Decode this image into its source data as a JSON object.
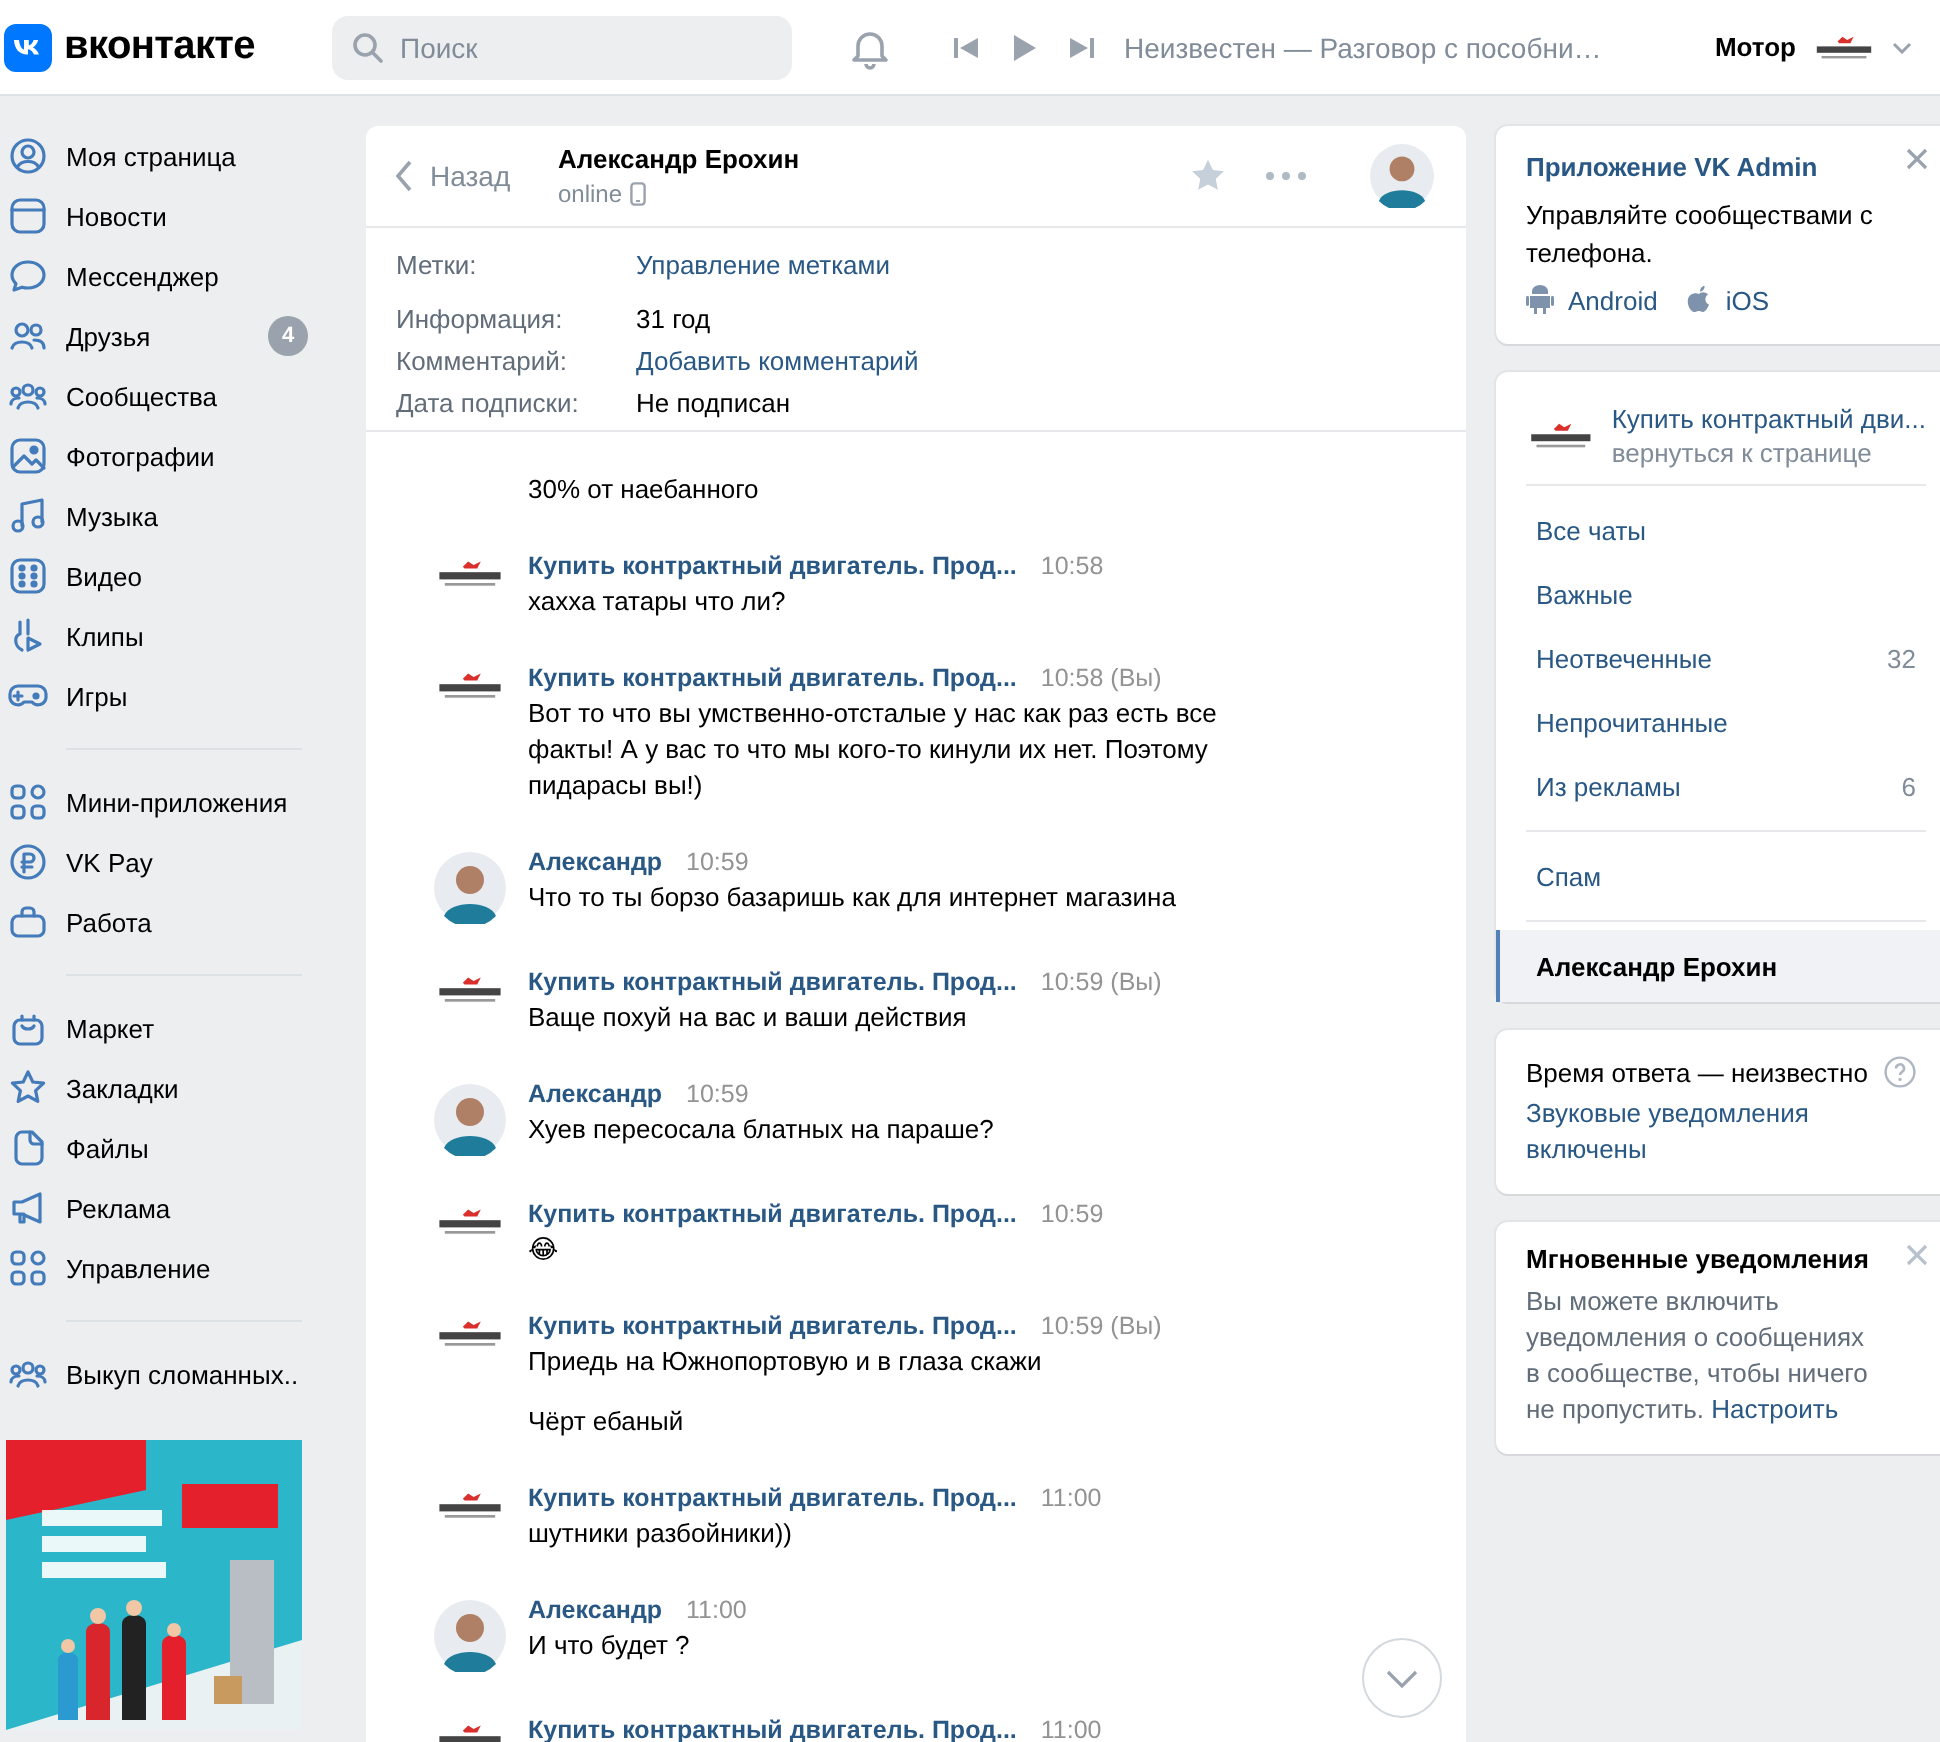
{
  "topbar": {
    "logo": "вконтакте",
    "search": {
      "placeholder": "Поиск"
    },
    "now_playing": "Неизвестен — Разговор с пособни…",
    "user": "Мотор"
  },
  "sidebar": {
    "groups": [
      {
        "items": [
          {
            "label": "Моя страница"
          },
          {
            "label": "Новости"
          },
          {
            "label": "Мессенджер"
          },
          {
            "label": "Друзья",
            "badge": "4"
          },
          {
            "label": "Сообщества"
          },
          {
            "label": "Фотографии"
          },
          {
            "label": "Музыка"
          },
          {
            "label": "Видео"
          },
          {
            "label": "Клипы"
          },
          {
            "label": "Игры"
          }
        ]
      },
      {
        "items": [
          {
            "label": "Мини-приложения"
          },
          {
            "label": "VK Pay"
          },
          {
            "label": "Работа"
          }
        ]
      },
      {
        "items": [
          {
            "label": "Маркет"
          },
          {
            "label": "Закладки"
          },
          {
            "label": "Файлы"
          },
          {
            "label": "Реклама"
          },
          {
            "label": "Управление"
          }
        ]
      },
      {
        "items": [
          {
            "label": "Выкуп сломанных.."
          }
        ]
      }
    ]
  },
  "chat": {
    "back": "Назад",
    "name": "Александр Ерохин",
    "status": "online",
    "info": [
      {
        "label": "Метки:",
        "value": "Управление метками",
        "kind": "link"
      },
      {
        "label": "Информация:",
        "value": "31 год",
        "kind": "text"
      },
      {
        "label": "Комментарий:",
        "value": "Добавить комментарий",
        "kind": "link"
      },
      {
        "label": "Дата подписки:",
        "value": "Не подписан",
        "kind": "text"
      }
    ],
    "messages": [
      {
        "texts": [
          "30% от наебанного"
        ]
      },
      {
        "kind": "group",
        "author": "Купить контрактный двигатель. Прод...",
        "time": "10:58",
        "texts": [
          "хахха татары что ли?"
        ]
      },
      {
        "kind": "group",
        "author": "Купить контрактный двигатель. Прод...",
        "time": "10:58 (Вы)",
        "texts": [
          "Вот то что вы умственно-отсталые у нас как раз есть все факты! А у вас то что мы кого-то кинули их нет. Поэтому пидарасы вы!)"
        ]
      },
      {
        "kind": "person",
        "author": "Александр",
        "time": "10:59",
        "texts": [
          "Что то ты борзо базаришь как для интернет магазина"
        ]
      },
      {
        "kind": "group",
        "author": "Купить контрактный двигатель. Прод...",
        "time": "10:59 (Вы)",
        "texts": [
          "Ваще похуй на вас и ваши действия"
        ]
      },
      {
        "kind": "person",
        "author": "Александр",
        "time": "10:59",
        "texts": [
          "Хуев пересосала блатных на параше?"
        ]
      },
      {
        "kind": "group",
        "author": "Купить контрактный двигатель. Прод...",
        "time": "10:59",
        "texts": [
          "😂"
        ]
      },
      {
        "kind": "group",
        "author": "Купить контрактный двигатель. Прод...",
        "time": "10:59 (Вы)",
        "texts": [
          "Приедь на Южнопортовую и в глаза скажи",
          "Чёрт ебаный"
        ]
      },
      {
        "kind": "group",
        "author": "Купить контрактный двигатель. Прод...",
        "time": "11:00",
        "texts": [
          "шутники разбойники))"
        ]
      },
      {
        "kind": "person",
        "author": "Александр",
        "time": "11:00",
        "texts": [
          "И что будет ?"
        ]
      },
      {
        "kind": "group",
        "author": "Купить контрактный двигатель. Прод...",
        "time": "11:00"
      }
    ]
  },
  "right": {
    "promo": {
      "title": "Приложение VK Admin",
      "text": "Управляйте сообществами с телефона.",
      "links": [
        "Android",
        "iOS"
      ]
    },
    "community": {
      "name": "Купить контрактный дви...",
      "back": "вернуться к странице",
      "groups": [
        {
          "items": [
            {
              "label": "Все чаты",
              "selected": false
            },
            {
              "label": "Важные",
              "selected": false
            },
            {
              "label": "Неотвеченные",
              "count": "32",
              "selected": false
            },
            {
              "label": "Непрочитанные",
              "selected": false
            },
            {
              "label": "Из рекламы",
              "count": "6",
              "selected": false
            }
          ]
        },
        {
          "items": [
            {
              "label": "Спам",
              "selected": false
            }
          ]
        },
        {
          "items": [
            {
              "label": "Александр Ерохин",
              "selected": true
            }
          ]
        }
      ]
    },
    "response": {
      "text": "Время ответа — неизвестно",
      "link": "Звуковые уведомления включены"
    },
    "notify": {
      "title": "Мгновенные уведомления",
      "text": "Вы можете включить уведомления о сообщениях в сообществе, чтобы ничего не пропустить.",
      "link": "Настроить"
    }
  }
}
